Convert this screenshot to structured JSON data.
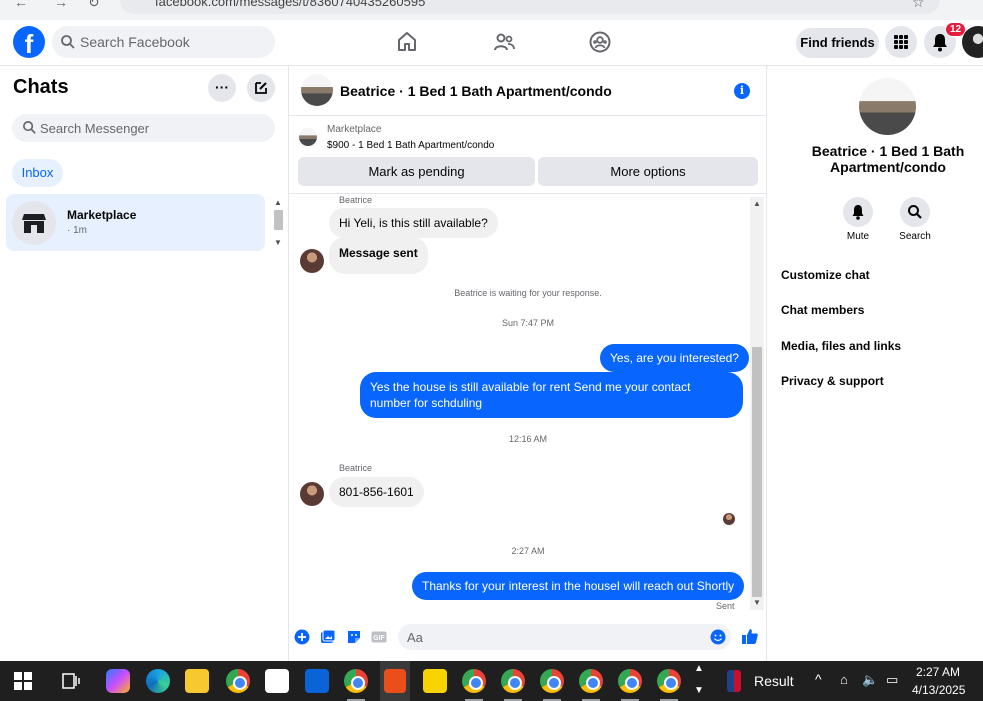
{
  "browser": {
    "url_partial": "facebook.com/messages/t/8360740435260595"
  },
  "topnav": {
    "search_placeholder": "Search Facebook",
    "find_friends": "Find friends",
    "notification_count": "12"
  },
  "sidebar": {
    "title": "Chats",
    "search_placeholder": "Search Messenger",
    "inbox_label": "Inbox",
    "chats": [
      {
        "name": "Marketplace",
        "time": "· 1m"
      }
    ]
  },
  "conversation": {
    "title": "Beatrice · 1 Bed 1 Bath Apartment/condo",
    "marketplace_label": "Marketplace",
    "listing": "$900 - 1 Bed 1 Bath Apartment/condo",
    "mark_pending": "Mark as pending",
    "more_options": "More options",
    "messages": {
      "sender1": "Beatrice",
      "m1": "Hi Yeli, is this still available?",
      "m2": "Message sent",
      "waiting": "Beatrice is waiting for your response.",
      "ts1": "Sun 7:47 PM",
      "m3": "Yes, are you interested?",
      "m4": "Yes the house is still available for rent Send me your contact number for schduling",
      "ts2": "12:16 AM",
      "sender2": "Beatrice",
      "m5": "801-856-1601",
      "ts3": "2:27 AM",
      "m6": "Thanks for your interest in the houseI will reach out Shortly",
      "sent": "Sent"
    },
    "composer_placeholder": "Aa"
  },
  "right_panel": {
    "name": "Beatrice · 1 Bed 1 Bath Apartment/condo",
    "mute": "Mute",
    "search": "Search",
    "links": [
      "Customize chat",
      "Chat members",
      "Media, files and links",
      "Privacy & support"
    ]
  },
  "taskbar": {
    "result_label": "Result",
    "time": "2:27 AM",
    "date": "4/13/2025"
  },
  "colors": {
    "brand": "#0866ff",
    "bubble_in": "#f0f0f0",
    "badge": "#e41e3f"
  }
}
